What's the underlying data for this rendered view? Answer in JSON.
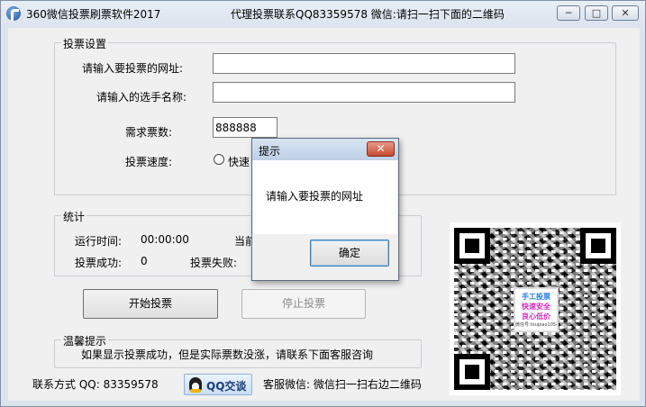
{
  "window": {
    "title": "360微信投票刷票软件2017",
    "notice": "代理投票联系QQ83359578 微信:请扫一扫下面的二维码",
    "minimize_glyph": "─",
    "maximize_glyph": "□",
    "close_glyph": "✕"
  },
  "vote_settings": {
    "legend": "投票设置",
    "url_label": "请输入要投票的网址:",
    "url_value": "",
    "candidate_label": "请输入的选手名称:",
    "candidate_value": "",
    "votes_label": "需求票数:",
    "votes_value": "888888",
    "speed_label": "投票速度:",
    "speed_option_fast": "快速"
  },
  "stats": {
    "legend": "统计",
    "runtime_label": "运行时间:",
    "runtime_value": "00:00:00",
    "current_label": "当前",
    "success_label": "投票成功:",
    "success_value": "0",
    "fail_label": "投票失败:"
  },
  "buttons": {
    "start": "开始投票",
    "stop": "停止投票"
  },
  "tips": {
    "legend": "温馨提示",
    "text": "如果显示投票成功，但是实际票数没涨，请联系下面客服咨询"
  },
  "footer": {
    "contact": "联系方式 QQ: 83359578",
    "qq_button": "QQ交谈",
    "wechat": "客服微信: 微信扫一扫右边二维码"
  },
  "qr_badge": {
    "line1": "手工投票",
    "line2": "快速安全",
    "line3": "良心低价",
    "line4": "微信号:toupiao10543"
  },
  "dialog": {
    "title": "提示",
    "message": "请输入要投票的网址",
    "ok": "确定",
    "close_glyph": "✕"
  },
  "colors": {
    "qq_blue": "#1a3c78",
    "badge_blue": "#1e7be0",
    "badge_magenta": "#d629c4",
    "dialog_close_red": "#c64a32"
  }
}
